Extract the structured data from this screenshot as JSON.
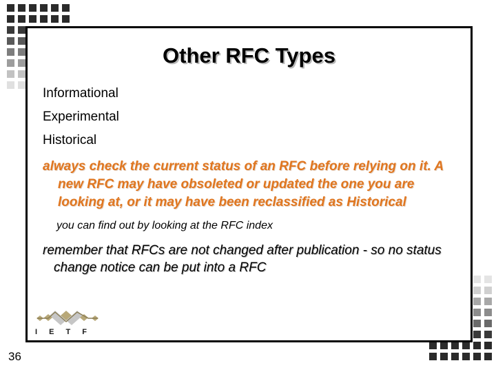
{
  "slide": {
    "title": "Other RFC Types",
    "page_number": "36",
    "types": [
      {
        "label": "Informational"
      },
      {
        "label": "Experimental"
      },
      {
        "label": "Historical"
      }
    ],
    "emphasis_paragraph": "always check the current status of an RFC before relying on it. A new RFC may have obsoleted or updated the one you are looking at, or it may have been reclassified as Historical",
    "note_line": "you can find out by looking at the RFC index",
    "closing_paragraph": "remember that RFCs are not changed after publication - so no status change notice can be put into a RFC"
  },
  "logo": {
    "name": "ietf-logo",
    "text": "I E T F"
  },
  "colors": {
    "emphasis_orange": "#e0761f",
    "text_black": "#000000",
    "frame_black": "#000000",
    "shadow_gray": "#bdbdbd",
    "logo_tan": "#b8a878",
    "logo_gray": "#c6c6c6",
    "dot_darkest": "#2b2b2b",
    "dot_lightest": "#e4e4e4"
  },
  "decor": {
    "top_left_grid": {
      "name": "top-left-dot-grid",
      "rows": [
        {
          "count": 6,
          "color": "#2b2b2b"
        },
        {
          "count": 6,
          "color": "#2b2b2b"
        },
        {
          "count": 2,
          "color": "#3a3a3a"
        },
        {
          "count": 2,
          "color": "#5a5a5a"
        },
        {
          "count": 2,
          "color": "#7e7e7e"
        },
        {
          "count": 2,
          "color": "#9d9d9d"
        },
        {
          "count": 2,
          "color": "#c2c2c2"
        },
        {
          "count": 2,
          "color": "#e0e0e0"
        }
      ]
    },
    "bottom_right_grid": {
      "name": "bottom-right-dot-grid",
      "rows": [
        {
          "count": 2,
          "color": "#e4e4e4"
        },
        {
          "count": 2,
          "color": "#d0d0d0"
        },
        {
          "count": 2,
          "color": "#a8a8a8"
        },
        {
          "count": 2,
          "color": "#8c8c8c"
        },
        {
          "count": 2,
          "color": "#6a6a6a"
        },
        {
          "count": 2,
          "color": "#3a3a3a"
        },
        {
          "count": 6,
          "color": "#2b2b2b"
        },
        {
          "count": 6,
          "color": "#2b2b2b"
        }
      ]
    }
  }
}
